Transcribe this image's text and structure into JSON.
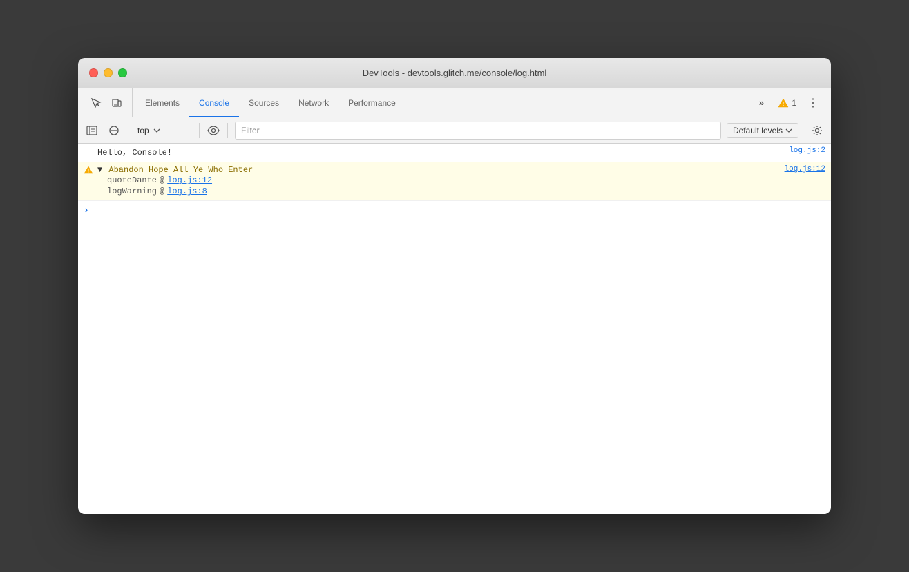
{
  "window": {
    "title": "DevTools - devtools.glitch.me/console/log.html"
  },
  "tabs": {
    "items": [
      {
        "label": "Elements",
        "active": false
      },
      {
        "label": "Console",
        "active": true
      },
      {
        "label": "Sources",
        "active": false
      },
      {
        "label": "Network",
        "active": false
      },
      {
        "label": "Performance",
        "active": false
      }
    ],
    "more_label": "»",
    "warning_count": "1",
    "more_options_label": "⋮"
  },
  "console_toolbar": {
    "context_value": "top",
    "filter_placeholder": "Filter",
    "default_levels_label": "Default levels"
  },
  "console_output": {
    "rows": [
      {
        "type": "log",
        "text": "Hello, Console!",
        "source": "log.js:2"
      },
      {
        "type": "warning",
        "text": "Abandon Hope All Ye Who Enter",
        "source": "log.js:12",
        "expanded": true,
        "stack": [
          {
            "fn": "quoteDante",
            "at": "@",
            "link": "log.js:12"
          },
          {
            "fn": "logWarning",
            "at": "@",
            "link": "log.js:8"
          }
        ]
      }
    ]
  },
  "colors": {
    "active_tab": "#1a73e8",
    "warning_bg": "#fffde7",
    "link_color": "#1a73e8",
    "warning_icon": "#f9ab00"
  }
}
